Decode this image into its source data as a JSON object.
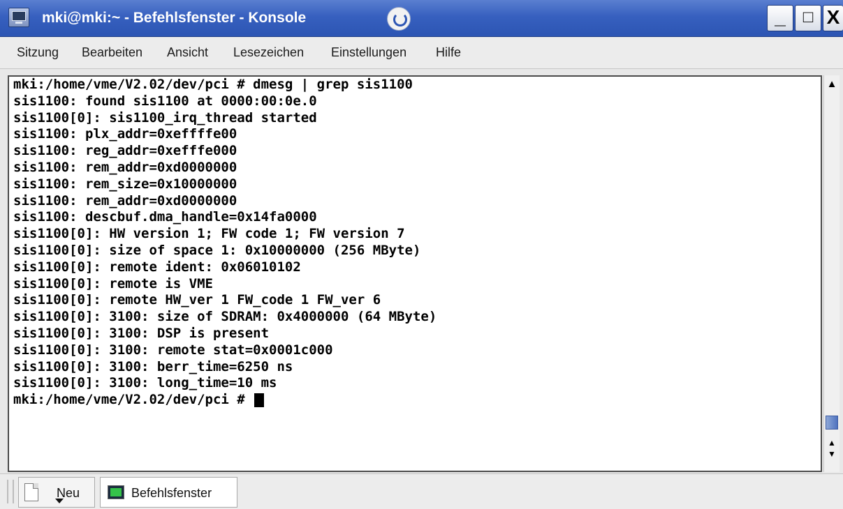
{
  "window": {
    "title": "mki@mki:~ - Befehlsfenster - Konsole",
    "minimize_label": "_",
    "maximize_label": "□",
    "close_label": "X"
  },
  "menubar": {
    "items": [
      {
        "label": "Sitzung"
      },
      {
        "label": "Bearbeiten"
      },
      {
        "label": "Ansicht"
      },
      {
        "label": "Lesezeichen"
      },
      {
        "label": "Einstellungen"
      },
      {
        "label": "Hilfe"
      }
    ]
  },
  "terminal": {
    "lines": [
      "mki:/home/vme/V2.02/dev/pci # dmesg | grep sis1100",
      "sis1100: found sis1100 at 0000:00:0e.0",
      "sis1100[0]: sis1100_irq_thread started",
      "sis1100: plx_addr=0xeffffe00",
      "sis1100: reg_addr=0xefffe000",
      "sis1100: rem_addr=0xd0000000",
      "sis1100: rem_size=0x10000000",
      "sis1100: rem_addr=0xd0000000",
      "sis1100: descbuf.dma_handle=0x14fa0000",
      "sis1100[0]: HW version 1; FW code 1; FW version 7",
      "sis1100[0]: size of space 1: 0x10000000 (256 MByte)",
      "sis1100[0]: remote ident: 0x06010102",
      "sis1100[0]: remote is VME",
      "sis1100[0]: remote HW_ver 1 FW_code 1 FW_ver 6",
      "sis1100[0]: 3100: size of SDRAM: 0x4000000 (64 MByte)",
      "sis1100[0]: 3100: DSP is present",
      "sis1100[0]: 3100: remote stat=0x0001c000",
      "sis1100[0]: 3100: berr_time=6250 ns",
      "sis1100[0]: 3100: long_time=10 ms"
    ],
    "prompt": "mki:/home/vme/V2.02/dev/pci # "
  },
  "taskbar": {
    "new_tab_label": "Neu",
    "session_tab_label": "Befehlsfenster"
  }
}
